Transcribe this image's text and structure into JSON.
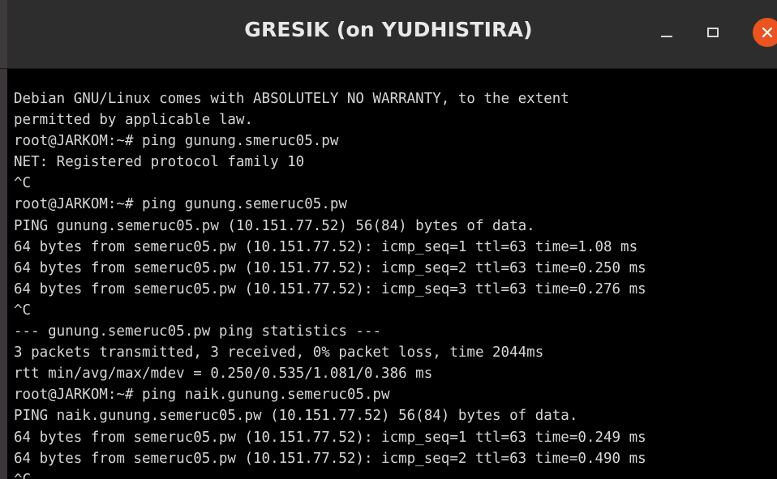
{
  "window": {
    "title": "GRESIK (on YUDHISTIRA)"
  },
  "controls": {
    "minimize": "minimize-icon",
    "maximize": "maximize-icon",
    "close": "close-icon",
    "close_color": "#e95420"
  },
  "terminal": {
    "lines": [
      "Debian GNU/Linux comes with ABSOLUTELY NO WARRANTY, to the extent",
      "permitted by applicable law.",
      "root@JARKOM:~# ping gunung.smeruc05.pw",
      "NET: Registered protocol family 10",
      "^C",
      "root@JARKOM:~# ping gunung.semeruc05.pw",
      "PING gunung.semeruc05.pw (10.151.77.52) 56(84) bytes of data.",
      "64 bytes from semeruc05.pw (10.151.77.52): icmp_seq=1 ttl=63 time=1.08 ms",
      "64 bytes from semeruc05.pw (10.151.77.52): icmp_seq=2 ttl=63 time=0.250 ms",
      "64 bytes from semeruc05.pw (10.151.77.52): icmp_seq=3 ttl=63 time=0.276 ms",
      "^C",
      "--- gunung.semeruc05.pw ping statistics ---",
      "3 packets transmitted, 3 received, 0% packet loss, time 2044ms",
      "rtt min/avg/max/mdev = 0.250/0.535/1.081/0.386 ms",
      "root@JARKOM:~# ping naik.gunung.semeruc05.pw",
      "PING naik.gunung.semeruc05.pw (10.151.77.52) 56(84) bytes of data.",
      "64 bytes from semeruc05.pw (10.151.77.52): icmp_seq=1 ttl=63 time=0.249 ms",
      "64 bytes from semeruc05.pw (10.151.77.52): icmp_seq=2 ttl=63 time=0.490 ms",
      "^C"
    ]
  }
}
